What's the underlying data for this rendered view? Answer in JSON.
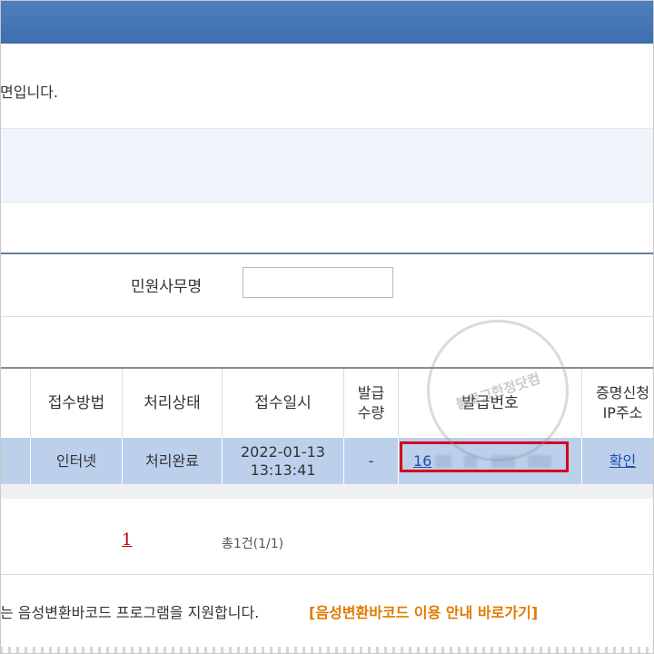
{
  "page": {
    "intro_text": "면입니다.",
    "search_label": "민원사무명",
    "search_value": ""
  },
  "table": {
    "headers": [
      "접수방법",
      "처리상태",
      "접수일시",
      "발급\n수량",
      "발급번호",
      "증명신청\nIP주소"
    ],
    "rows": [
      {
        "method": "인터넷",
        "status": "처리완료",
        "date": "2022-01-13",
        "time": "13:13:41",
        "quantity": "-",
        "issue_number_prefix": "16",
        "ip_link": "확인"
      }
    ]
  },
  "pagination": {
    "current": "1",
    "total": "총1건(1/1)"
  },
  "footer": {
    "barcode_note": "는 음성변환바코드 프로그램을 지원합니다.",
    "barcode_link": "[음성변환바코드 이용 안내 바로가기]"
  },
  "colors": {
    "header": "#3f6eaf",
    "row_highlight": "#bcd0ec",
    "highlight_box": "#d6001c",
    "link": "#1f4ea8",
    "accent_orange": "#e07a00"
  },
  "watermark": {
    "text": "블로그한정닷컴"
  }
}
